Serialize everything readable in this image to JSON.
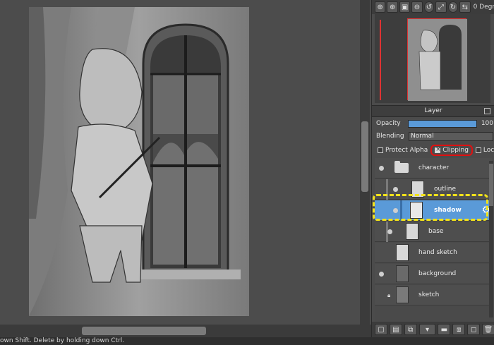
{
  "status_text": "own Shift. Delete by holding down Ctrl.",
  "navigator": {
    "degree_label": "0 Degr",
    "tools": [
      "zoom-in-icon",
      "zoom-in-2-icon",
      "fit-icon",
      "zoom-out-icon",
      "rotate-left-icon",
      "fit-screen-icon",
      "rotate-right-icon",
      "flip-icon"
    ]
  },
  "layer_panel": {
    "title": "Layer",
    "opacity_label": "Opacity",
    "opacity_value": "100",
    "opacity_percent": 100,
    "blending_label": "Blending",
    "blending_value": "Normal",
    "protect_alpha_label": "Protect Alpha",
    "clipping_label": "Clipping",
    "lock_label": "Lock",
    "layers": [
      {
        "name": "character",
        "type": "folder",
        "visible": true
      },
      {
        "name": "outline",
        "type": "layer",
        "visible": true
      },
      {
        "name": "shadow",
        "type": "layer",
        "visible": true,
        "selected": true
      },
      {
        "name": "base",
        "type": "layer",
        "visible": true
      },
      {
        "name": "hand sketch",
        "type": "layer",
        "visible": false
      },
      {
        "name": "background",
        "type": "layer",
        "visible": true
      },
      {
        "name": "sketch",
        "type": "layer",
        "visible": false,
        "locked": true
      }
    ],
    "bottom_tools": [
      "new-layer-icon",
      "new-layer-2-icon",
      "duplicate-icon",
      "import-icon",
      "new-folder-icon",
      "merge-icon",
      "clear-icon",
      "delete-icon"
    ]
  },
  "colors": {
    "accent": "#5a9ad8",
    "clipping_highlight": "#e01010",
    "selection_outline": "#f2e21a"
  }
}
